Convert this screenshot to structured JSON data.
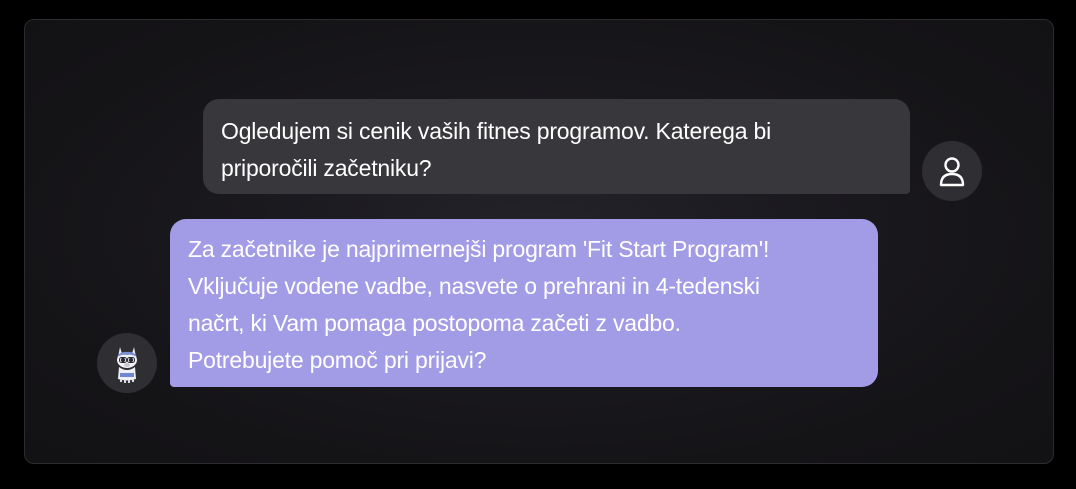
{
  "conversation": {
    "messages": [
      {
        "role": "user",
        "lines": [
          "Ogledujem si cenik vaših fitnes programov. Katerega bi",
          "priporočili začetniku?"
        ]
      },
      {
        "role": "assistant",
        "lines": [
          "Za začetnike je najprimernejši program 'Fit Start Program'!",
          "Vključuje vodene vadbe, nasvete o prehrani in 4-tedenski",
          "načrt, ki Vam pomaga postopoma začeti z vadbo.",
          "Potrebujete pomoč pri prijavi?"
        ]
      }
    ]
  },
  "icons": {
    "user_avatar": "user-icon",
    "bot_avatar": "llama-mascot-icon"
  },
  "colors": {
    "user_bubble": "#38373b",
    "bot_bubble": "#a29ce6",
    "avatar_bg": "#2f2e33",
    "panel_bg": "#1a191e"
  }
}
